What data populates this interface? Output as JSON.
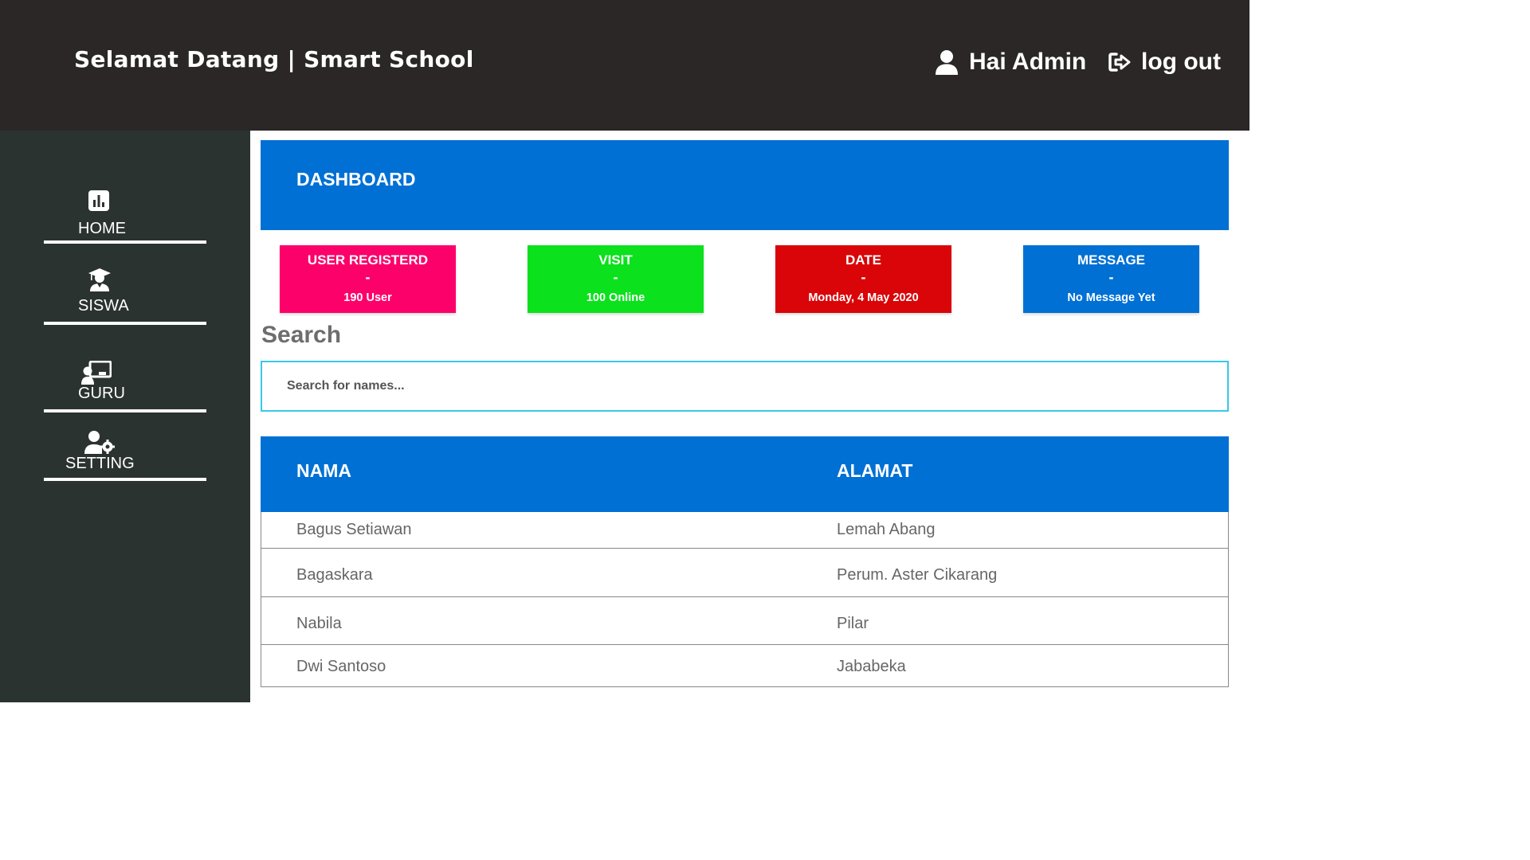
{
  "header": {
    "title": "Selamat Datang | Smart School",
    "user_icon": "user-icon",
    "user_label": "Hai Admin",
    "logout_icon": "sign-out-icon",
    "logout_label": "log out"
  },
  "sidebar": {
    "items": [
      {
        "label": "HOME",
        "icon": "chart-icon"
      },
      {
        "label": "SISWA",
        "icon": "graduate-icon"
      },
      {
        "label": "GURU",
        "icon": "teacher-board-icon"
      },
      {
        "label": "SETTING",
        "icon": "user-gear-icon"
      }
    ]
  },
  "dashboard": {
    "title": "DASHBOARD"
  },
  "cards": [
    {
      "title": "USER REGISTERD",
      "dash": "-",
      "value": "190 User",
      "color": "#fd016a"
    },
    {
      "title": "VISIT",
      "dash": "-",
      "value": "100 Online",
      "color": "#0be11c"
    },
    {
      "title": "DATE",
      "dash": "-",
      "value": "Monday, 4 May 2020",
      "color": "#d90508"
    },
    {
      "title": "MESSAGE",
      "dash": "-",
      "value": "No Message Yet",
      "color": "#0070d4"
    }
  ],
  "search": {
    "title": "Search",
    "placeholder": "Search for names..."
  },
  "table": {
    "headers": [
      "NAMA",
      "ALAMAT"
    ],
    "rows": [
      [
        "Bagus Setiawan",
        "Lemah Abang"
      ],
      [
        "Bagaskara",
        "Perum. Aster Cikarang"
      ],
      [
        "Nabila",
        "Pilar"
      ],
      [
        "Dwi Santoso",
        "Jababeka"
      ]
    ]
  },
  "colors": {
    "header_bg": "#2a2726",
    "sidebar_bg": "#2b3331",
    "accent": "#0070d4",
    "search_border": "#39c8e8"
  }
}
